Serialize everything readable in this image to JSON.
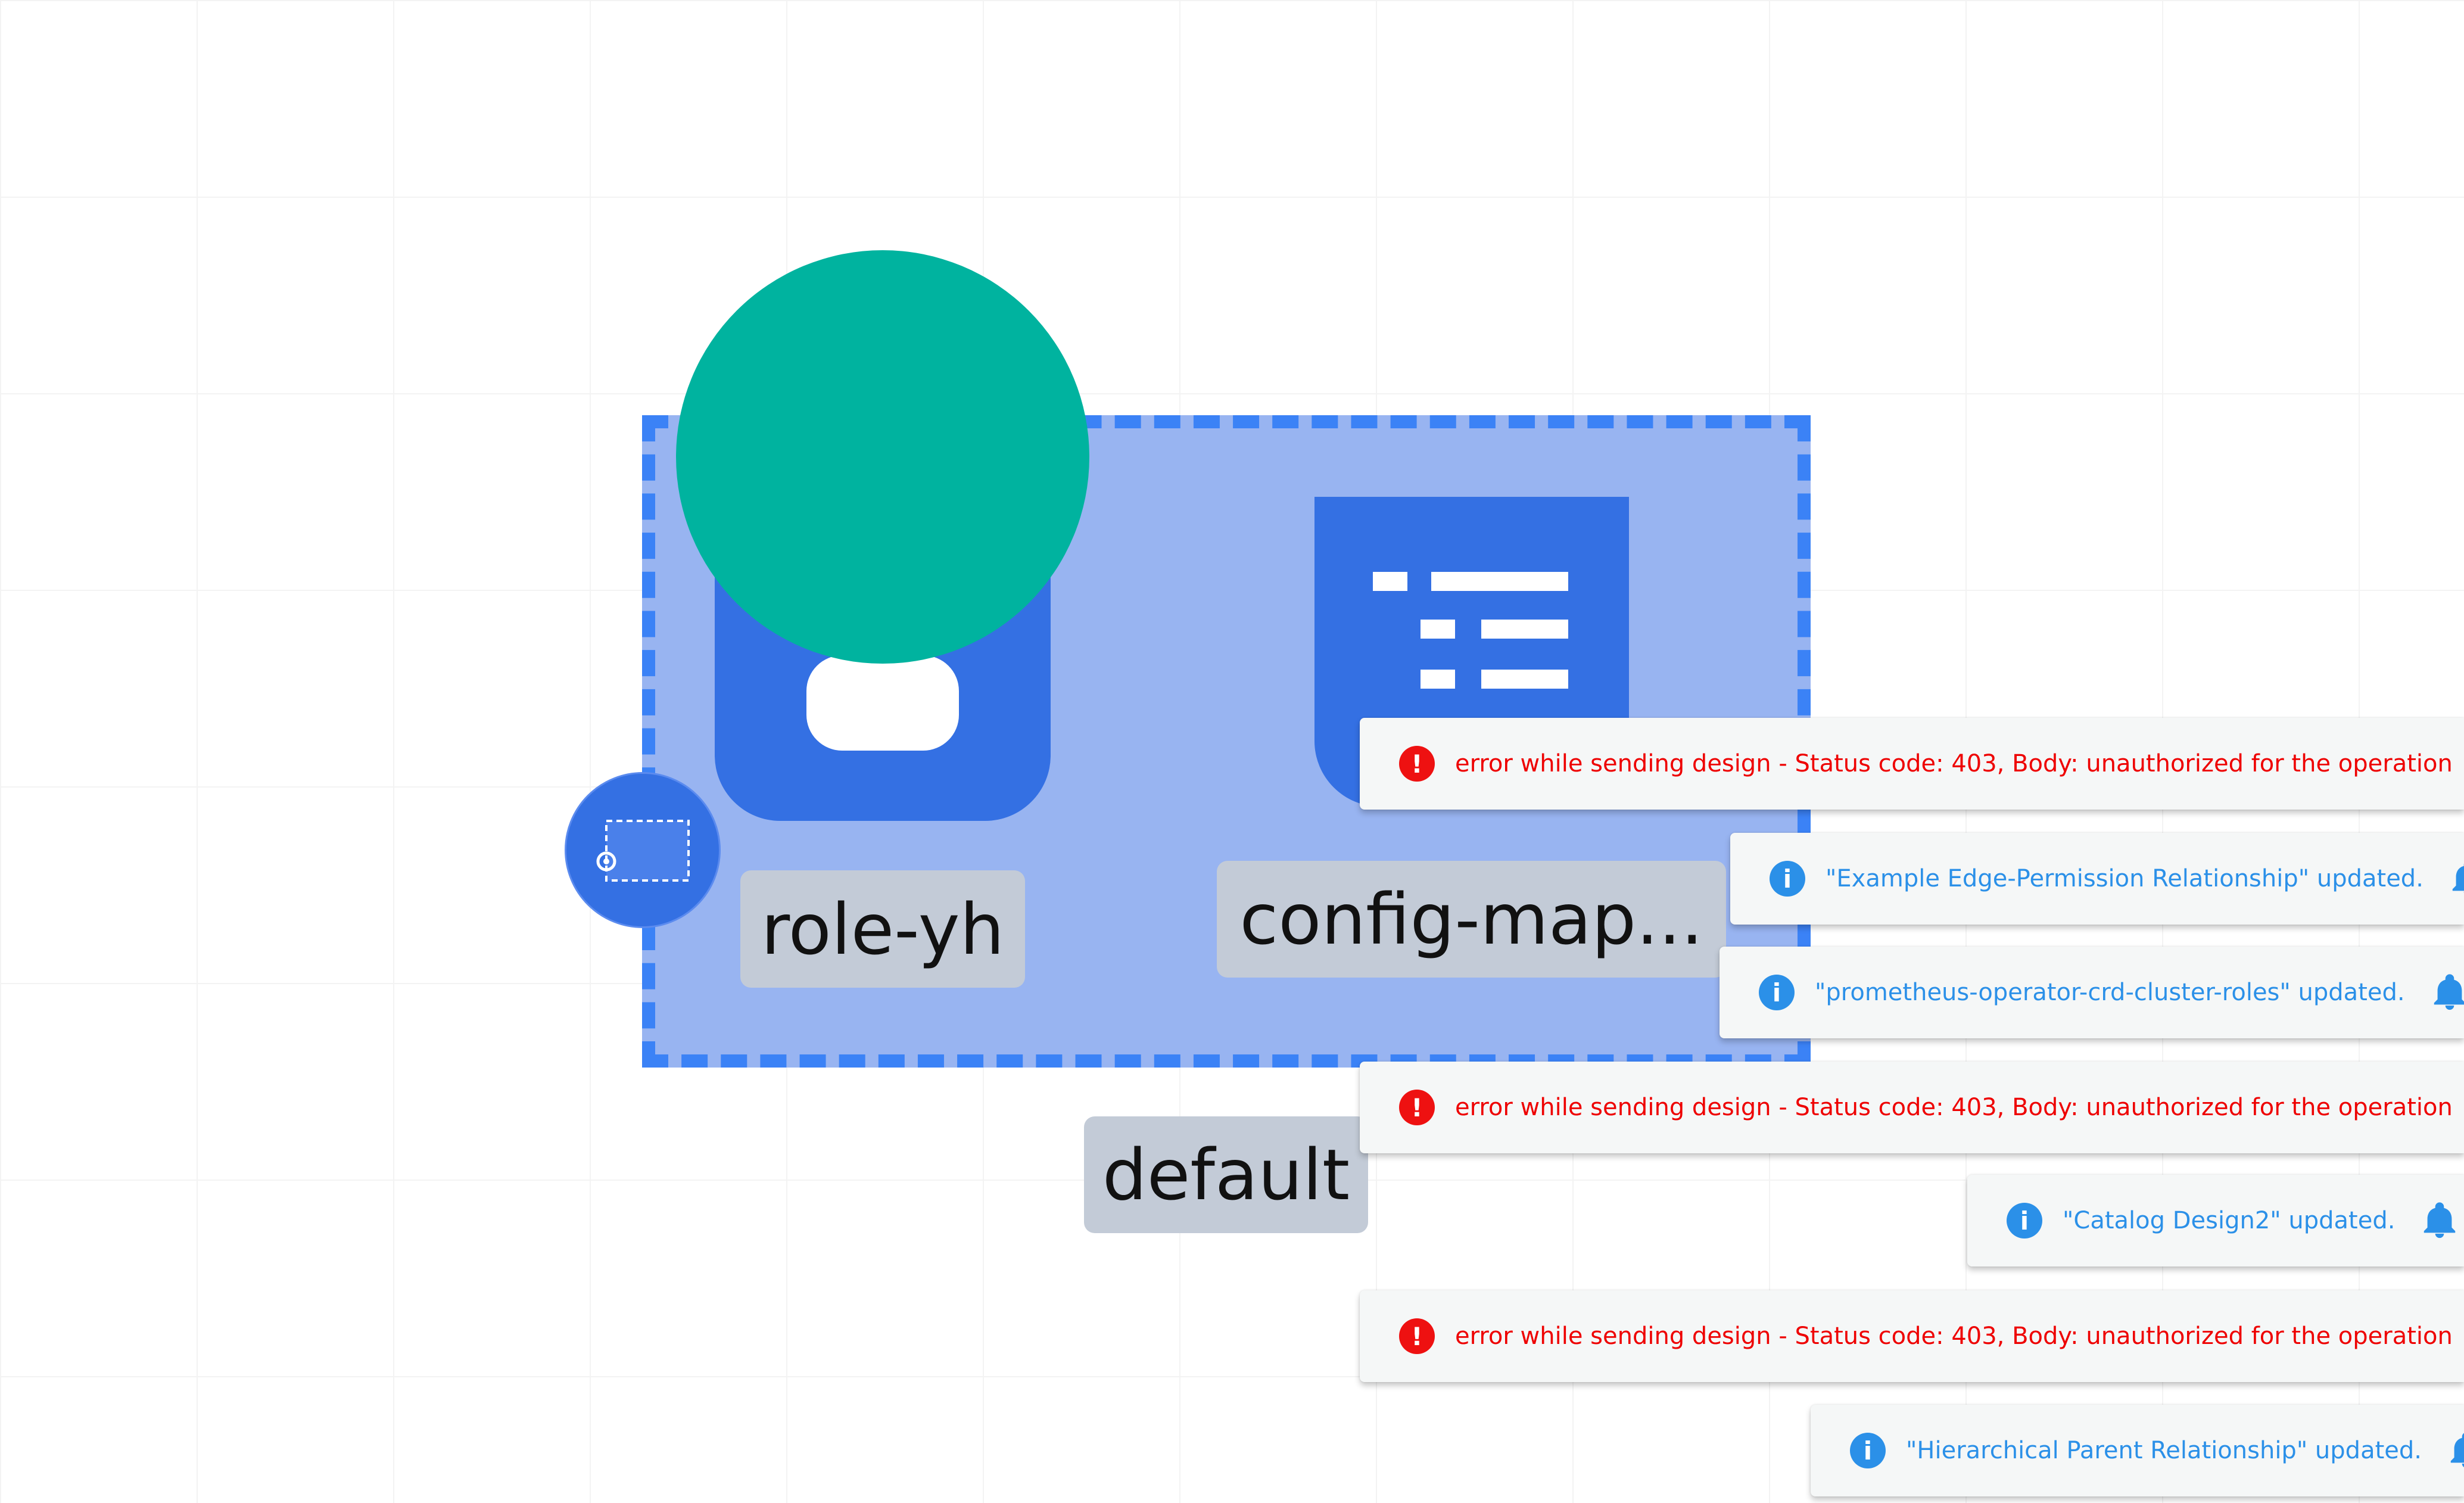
{
  "canvas": {
    "nodes": [
      {
        "id": "role",
        "label": "role-yh",
        "icon": "role-icon",
        "badge_icon": "teal-circle"
      },
      {
        "id": "config_map",
        "label": "config-map...",
        "icon": "config-map-icon"
      }
    ],
    "group": {
      "label": "default",
      "handle_icon": "group-select-icon"
    }
  },
  "notifications": [
    {
      "type": "error",
      "message": "error while sending design - Status code: 403, Body: unauthorized for the operation",
      "icon": "error-icon"
    },
    {
      "type": "info",
      "message": "\"Example Edge-Permission Relationship\" updated.",
      "icon": "info-icon"
    },
    {
      "type": "info",
      "message": "\"prometheus-operator-crd-cluster-roles\" updated.",
      "icon": "info-icon"
    },
    {
      "type": "error",
      "message": "error while sending design - Status code: 403, Body: unauthorized for the operation",
      "icon": "error-icon"
    },
    {
      "type": "info",
      "message": "\"Catalog Design2\" updated.",
      "icon": "info-icon"
    },
    {
      "type": "error",
      "message": "error while sending design - Status code: 403, Body: unauthorized for the operation",
      "icon": "error-icon"
    },
    {
      "type": "info",
      "message": "\"Hierarchical Parent Relationship\" updated.",
      "icon": "info-icon"
    }
  ],
  "colors": {
    "group_fill": "#98b4f1",
    "group_border": "#3b82f6",
    "node_blue": "#3470e3",
    "teal": "#00b39f",
    "label_bg": "#c3cbd7",
    "error": "#ee0000",
    "info": "#2b90e8"
  }
}
